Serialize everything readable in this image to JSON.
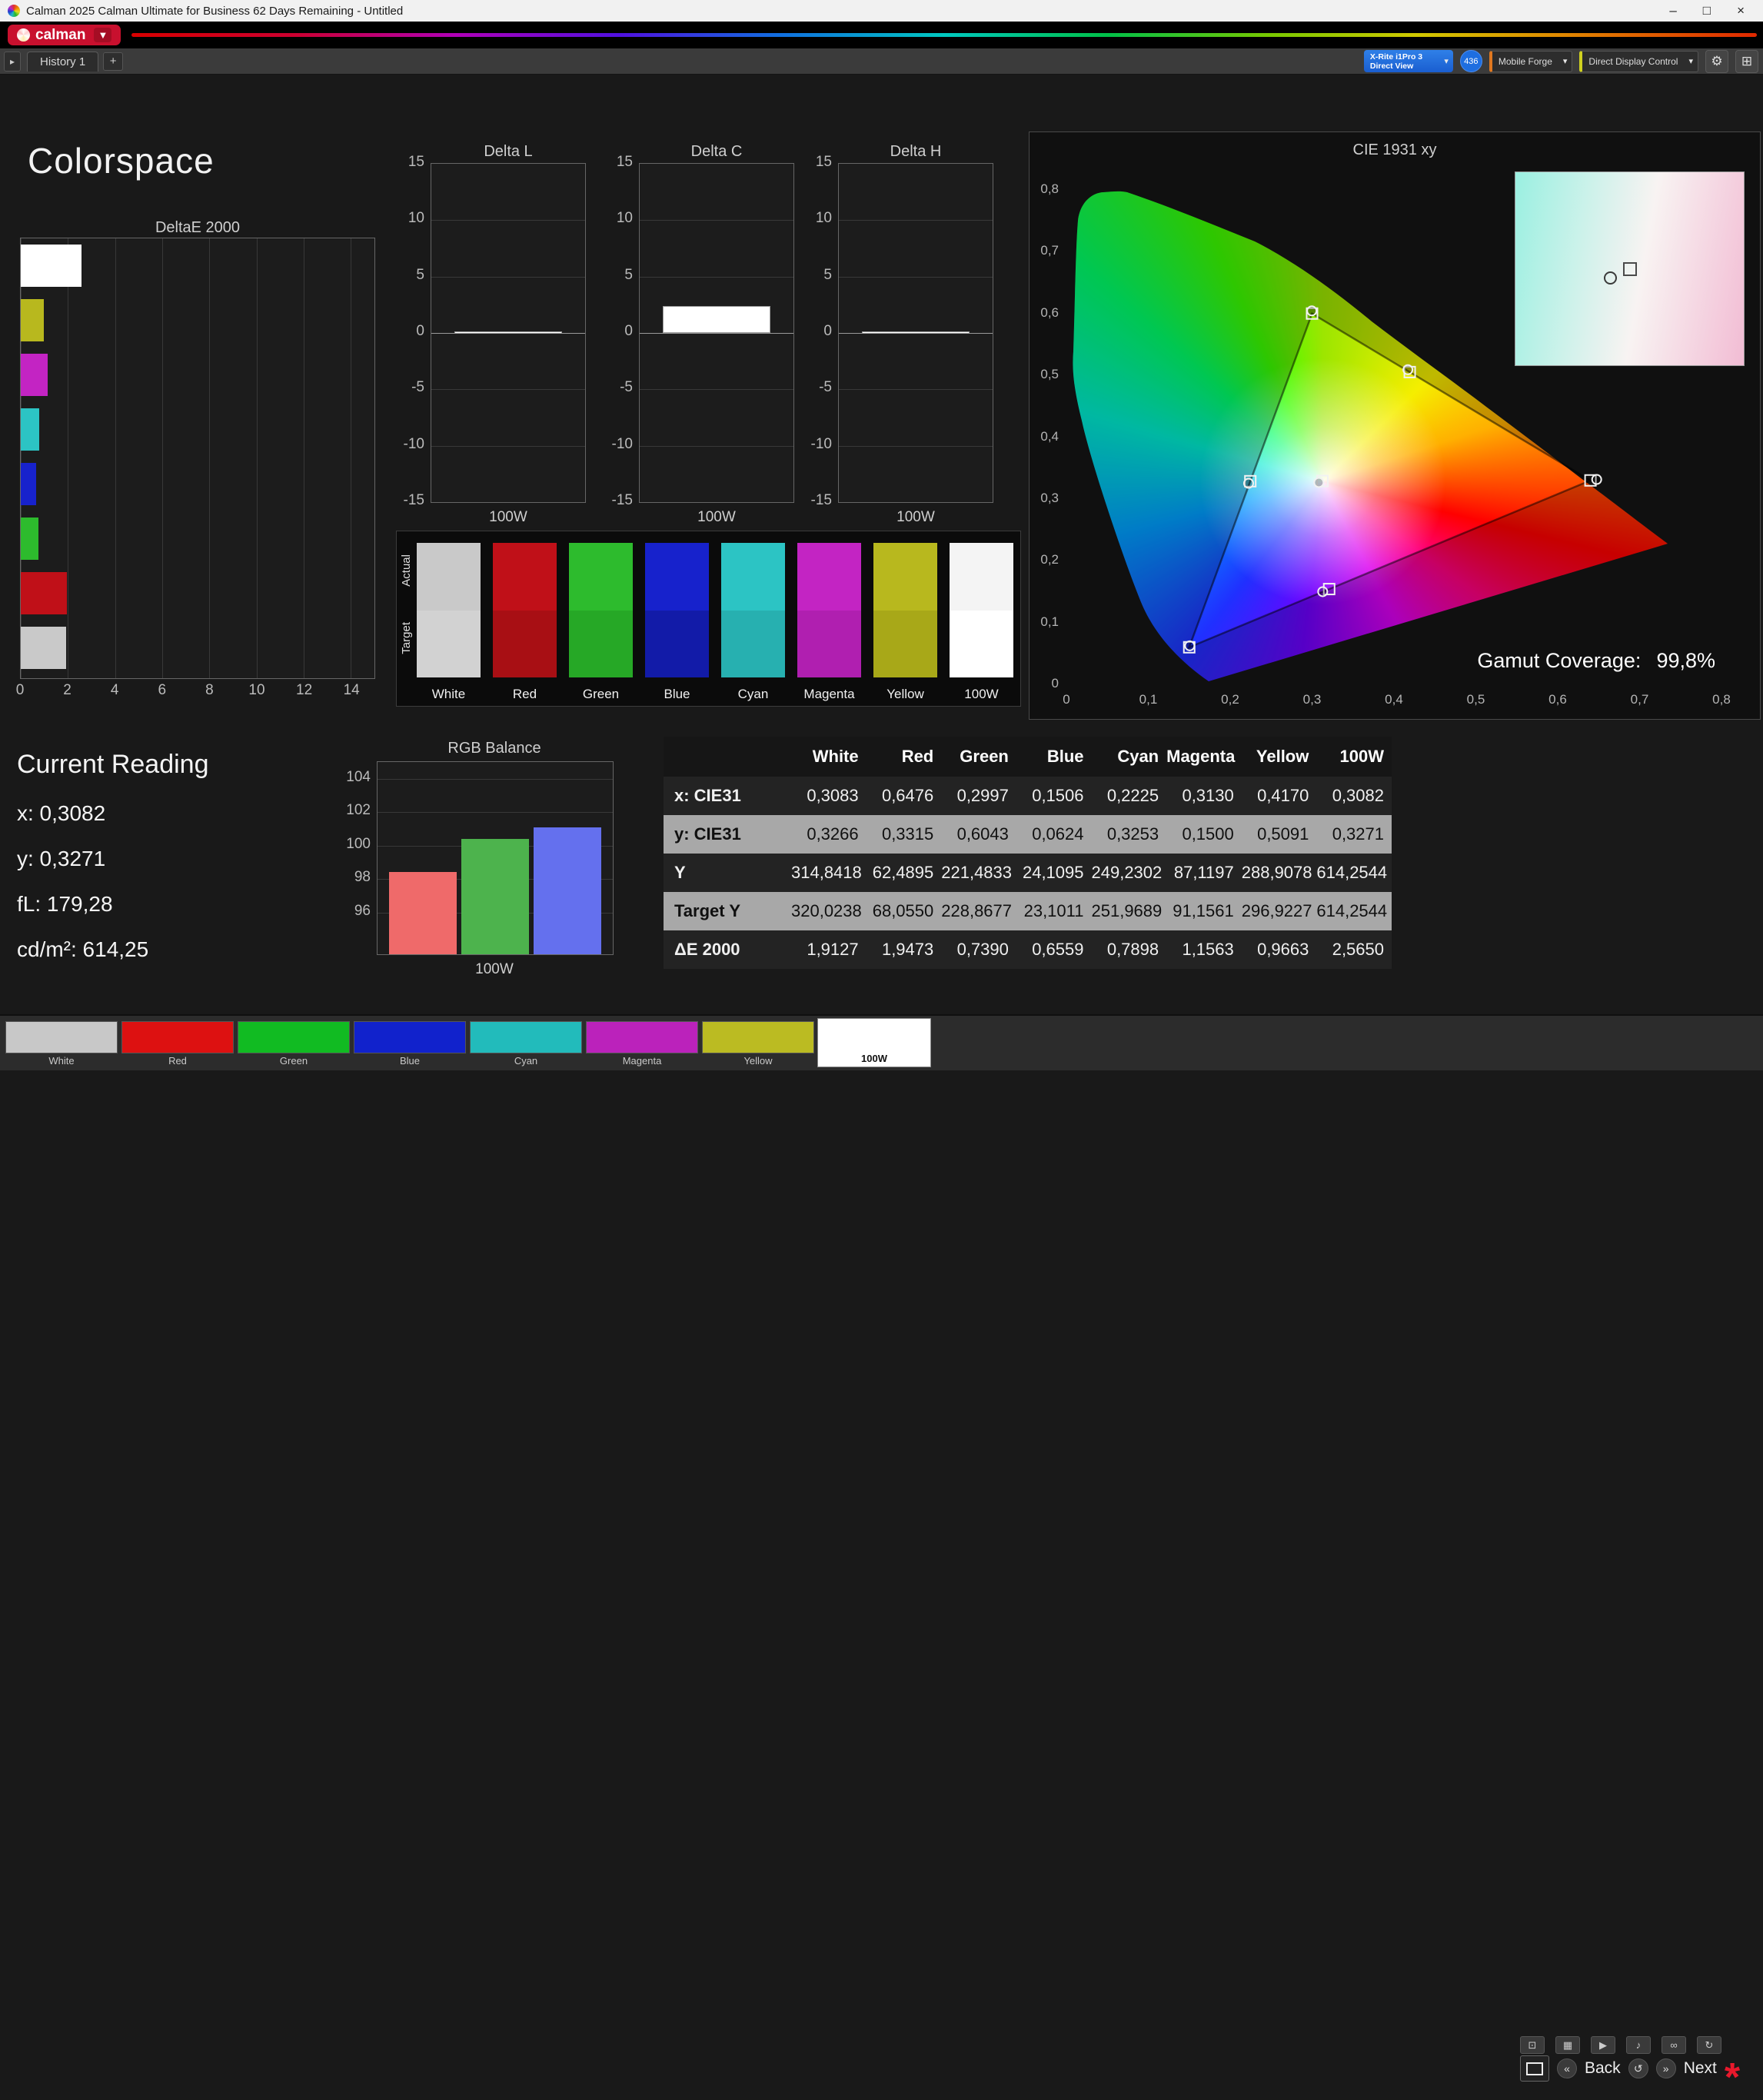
{
  "window": {
    "title": "Calman 2025 Calman Ultimate for Business 62 Days Remaining  - Untitled",
    "controls": {
      "minimize": "–",
      "maximize": "□",
      "close": "×"
    }
  },
  "brand": {
    "logo_text": "calman",
    "caret": "▼"
  },
  "toolbar": {
    "scroll_glyph": "▸",
    "history_tab": "History 1",
    "add_glyph": "+",
    "meter_line1": "X-Rite i1Pro 3",
    "meter_line2": "Direct View",
    "caret": "▾",
    "meter_badge": "436",
    "source_button": "Mobile Forge",
    "display_button": "Direct Display Control",
    "gear_glyph": "⚙",
    "grid_glyph": "⊞"
  },
  "page": {
    "title": "Colorspace"
  },
  "charts": {
    "deltae2000": {
      "type": "bar",
      "title": "DeltaE 2000",
      "x_ticks": [
        "0",
        "2",
        "4",
        "6",
        "8",
        "10",
        "12",
        "14"
      ],
      "xmax": 15,
      "series": [
        {
          "name": "100W",
          "color": "#ffffff",
          "value": 2.565
        },
        {
          "name": "Yellow",
          "color": "#b8b81e",
          "value": 0.9663
        },
        {
          "name": "Magenta",
          "color": "#c324c3",
          "value": 1.1563
        },
        {
          "name": "Cyan",
          "color": "#2cc4c4",
          "value": 0.7898
        },
        {
          "name": "Blue",
          "color": "#1722cc",
          "value": 0.6559
        },
        {
          "name": "Green",
          "color": "#2dbb2d",
          "value": 0.739
        },
        {
          "name": "Red",
          "color": "#c01018",
          "value": 1.9473
        },
        {
          "name": "White",
          "color": "#c9c9c9",
          "value": 1.9127
        }
      ]
    },
    "delta_l": {
      "type": "bar",
      "title": "Delta L",
      "xlabel": "100W",
      "value": 0,
      "ticks": [
        "15",
        "10",
        "5",
        "0",
        "-5",
        "-10",
        "-15"
      ],
      "ylim": [
        -15,
        15
      ]
    },
    "delta_c": {
      "type": "bar",
      "title": "Delta C",
      "xlabel": "100W",
      "value": 2.4,
      "ticks": [
        "15",
        "10",
        "5",
        "0",
        "-5",
        "-10",
        "-15"
      ],
      "ylim": [
        -15,
        15
      ]
    },
    "delta_h": {
      "type": "bar",
      "title": "Delta H",
      "xlabel": "100W",
      "value": 0,
      "ticks": [
        "15",
        "10",
        "5",
        "0",
        "-5",
        "-10",
        "-15"
      ],
      "ylim": [
        -15,
        15
      ]
    },
    "rgb_balance": {
      "type": "bar",
      "title": "RGB Balance",
      "xlabel": "100W",
      "ymin": 93.5,
      "ymax": 105,
      "ticks": [
        104,
        102,
        100,
        98,
        96
      ],
      "bars": [
        {
          "name": "Red",
          "value": 98.4,
          "color": "#ef6a6a"
        },
        {
          "name": "Green",
          "value": 100.4,
          "color": "#4db34d"
        },
        {
          "name": "Blue",
          "value": 101.1,
          "color": "#6470ee"
        }
      ]
    },
    "cie": {
      "title": "CIE 1931 xy",
      "x_ticks": [
        "0",
        "0,1",
        "0,2",
        "0,3",
        "0,4",
        "0,5",
        "0,6",
        "0,7",
        "0,8"
      ],
      "y_ticks": [
        "0,8",
        "0,7",
        "0,6",
        "0,5",
        "0,4",
        "0,3",
        "0,2",
        "0,1",
        "0"
      ],
      "axis_max": 0.8,
      "gamut_coverage_label": "Gamut Coverage:",
      "gamut_coverage_value": "99,8%",
      "triangle": [
        [
          0.64,
          0.33
        ],
        [
          0.3,
          0.6
        ],
        [
          0.15,
          0.06
        ]
      ],
      "points": [
        {
          "name": "White",
          "x": 0.3083,
          "y": 0.3266,
          "tx": 0.3127,
          "ty": 0.329
        },
        {
          "name": "Red",
          "x": 0.6476,
          "y": 0.3315,
          "tx": 0.64,
          "ty": 0.33
        },
        {
          "name": "Green",
          "x": 0.2997,
          "y": 0.6043,
          "tx": 0.3,
          "ty": 0.6
        },
        {
          "name": "Blue",
          "x": 0.1506,
          "y": 0.0624,
          "tx": 0.15,
          "ty": 0.06
        },
        {
          "name": "Cyan",
          "x": 0.2225,
          "y": 0.3253,
          "tx": 0.2246,
          "ty": 0.3287
        },
        {
          "name": "Magenta",
          "x": 0.313,
          "y": 0.15,
          "tx": 0.3209,
          "ty": 0.1542
        },
        {
          "name": "Yellow",
          "x": 0.417,
          "y": 0.5091,
          "tx": 0.4193,
          "ty": 0.5053
        }
      ]
    }
  },
  "swatches": {
    "actual_label": "Actual",
    "target_label": "Target",
    "columns": [
      {
        "name": "White",
        "actual": "#c9c9c9",
        "target": "#d2d2d2"
      },
      {
        "name": "Red",
        "actual": "#c01018",
        "target": "#a80f14"
      },
      {
        "name": "Green",
        "actual": "#2dbb2d",
        "target": "#26a826"
      },
      {
        "name": "Blue",
        "actual": "#1722cc",
        "target": "#121ba8"
      },
      {
        "name": "Cyan",
        "actual": "#2cc4c4",
        "target": "#27b0b0"
      },
      {
        "name": "Magenta",
        "actual": "#c324c3",
        "target": "#b01fb0"
      },
      {
        "name": "Yellow",
        "actual": "#b8b81e",
        "target": "#a8a818"
      },
      {
        "name": "100W",
        "actual": "#f4f4f4",
        "target": "#ffffff"
      }
    ]
  },
  "current_reading": {
    "title": "Current Reading",
    "lines": [
      "x: 0,3082",
      "y: 0,3271",
      "fL: 179,28",
      "cd/m²: 614,25"
    ]
  },
  "table": {
    "columns": [
      "White",
      "Red",
      "Green",
      "Blue",
      "Cyan",
      "Magenta",
      "Yellow",
      "100W"
    ],
    "rows": [
      {
        "label": "x: CIE31",
        "values": [
          "0,3083",
          "0,6476",
          "0,2997",
          "0,1506",
          "0,2225",
          "0,3130",
          "0,4170",
          "0,3082"
        ]
      },
      {
        "label": "y: CIE31",
        "values": [
          "0,3266",
          "0,3315",
          "0,6043",
          "0,0624",
          "0,3253",
          "0,1500",
          "0,5091",
          "0,3271"
        ]
      },
      {
        "label": "Y",
        "values": [
          "314,8418",
          "62,4895",
          "221,4833",
          "24,1095",
          "249,2302",
          "87,1197",
          "288,9078",
          "614,2544"
        ]
      },
      {
        "label": "Target Y",
        "values": [
          "320,0238",
          "68,0550",
          "228,8677",
          "23,1011",
          "251,9689",
          "91,1561",
          "296,9227",
          "614,2544"
        ]
      },
      {
        "label": "ΔE 2000",
        "values": [
          "1,9127",
          "1,9473",
          "0,7390",
          "0,6559",
          "0,7898",
          "1,1563",
          "0,9663",
          "2,5650"
        ]
      }
    ]
  },
  "pattern_bar": {
    "selected_index": 7,
    "buttons": [
      {
        "label": "White",
        "color": "#c8c8c8"
      },
      {
        "label": "Red",
        "color": "#dd1111"
      },
      {
        "label": "Green",
        "color": "#11bb22"
      },
      {
        "label": "Blue",
        "color": "#1122cc"
      },
      {
        "label": "Cyan",
        "color": "#22bbbb"
      },
      {
        "label": "Magenta",
        "color": "#bb22bb"
      },
      {
        "label": "Yellow",
        "color": "#bbbb22"
      },
      {
        "label": "100W",
        "color": "#ffffff"
      }
    ]
  },
  "nav": {
    "util_icons": [
      {
        "name": "display-icon",
        "glyph": "⊡"
      },
      {
        "name": "pattern-grid-icon",
        "glyph": "▦"
      },
      {
        "name": "play-icon",
        "glyph": "▶"
      },
      {
        "name": "audio-icon",
        "glyph": "♪"
      },
      {
        "name": "link-icon",
        "glyph": "∞"
      },
      {
        "name": "refresh-icon",
        "glyph": "↻"
      }
    ],
    "back_icon": "«",
    "back": "Back",
    "mid_icons": [
      {
        "name": "loop-icon",
        "glyph": "↺"
      },
      {
        "name": "forward-icon",
        "glyph": "»"
      }
    ],
    "next": "Next",
    "alert_glyph": "*"
  }
}
